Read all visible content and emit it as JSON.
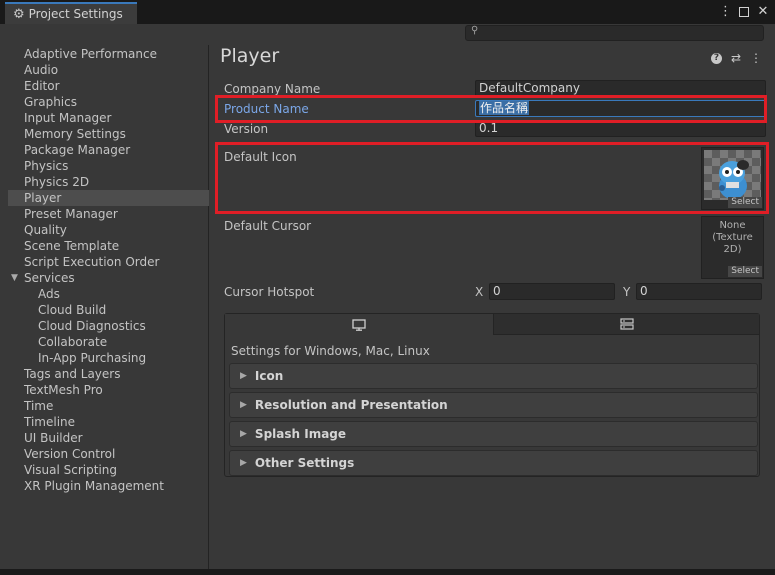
{
  "window": {
    "tab_title": "Project Settings",
    "controls": [
      "⋮",
      "□",
      "✕"
    ]
  },
  "search": {
    "placeholder": "",
    "value": ""
  },
  "sidebar": {
    "items": [
      {
        "label": "Adaptive Performance"
      },
      {
        "label": "Audio"
      },
      {
        "label": "Editor"
      },
      {
        "label": "Graphics"
      },
      {
        "label": "Input Manager"
      },
      {
        "label": "Memory Settings"
      },
      {
        "label": "Package Manager"
      },
      {
        "label": "Physics"
      },
      {
        "label": "Physics 2D"
      },
      {
        "label": "Player",
        "selected": true
      },
      {
        "label": "Preset Manager"
      },
      {
        "label": "Quality"
      },
      {
        "label": "Scene Template"
      },
      {
        "label": "Script Execution Order"
      },
      {
        "label": "Services",
        "expanded": true
      },
      {
        "label": "Ads",
        "sub": true
      },
      {
        "label": "Cloud Build",
        "sub": true
      },
      {
        "label": "Cloud Diagnostics",
        "sub": true
      },
      {
        "label": "Collaborate",
        "sub": true
      },
      {
        "label": "In-App Purchasing",
        "sub": true
      },
      {
        "label": "Tags and Layers"
      },
      {
        "label": "TextMesh Pro"
      },
      {
        "label": "Time"
      },
      {
        "label": "Timeline"
      },
      {
        "label": "UI Builder"
      },
      {
        "label": "Version Control"
      },
      {
        "label": "Visual Scripting"
      },
      {
        "label": "XR Plugin Management"
      }
    ]
  },
  "main": {
    "title": "Player",
    "company_name_label": "Company Name",
    "company_name_value": "DefaultCompany",
    "product_name_label": "Product Name",
    "product_name_value": "作品名稱",
    "version_label": "Version",
    "version_value": "0.1",
    "default_icon_label": "Default Icon",
    "default_icon_select": "Select",
    "default_cursor_label": "Default Cursor",
    "default_cursor_none": "None",
    "default_cursor_type": "(Texture 2D)",
    "default_cursor_select": "Select",
    "cursor_hotspot_label": "Cursor Hotspot",
    "hotspot_x_label": "X",
    "hotspot_x_value": "0",
    "hotspot_y_label": "Y",
    "hotspot_y_value": "0",
    "platform_settings_label": "Settings for Windows, Mac, Linux",
    "foldouts": [
      "Icon",
      "Resolution and Presentation",
      "Splash Image",
      "Other Settings"
    ]
  },
  "colors": {
    "highlight_box": "#e01e26",
    "accent": "#3a79bb",
    "label_focus": "#7ba7e8"
  }
}
